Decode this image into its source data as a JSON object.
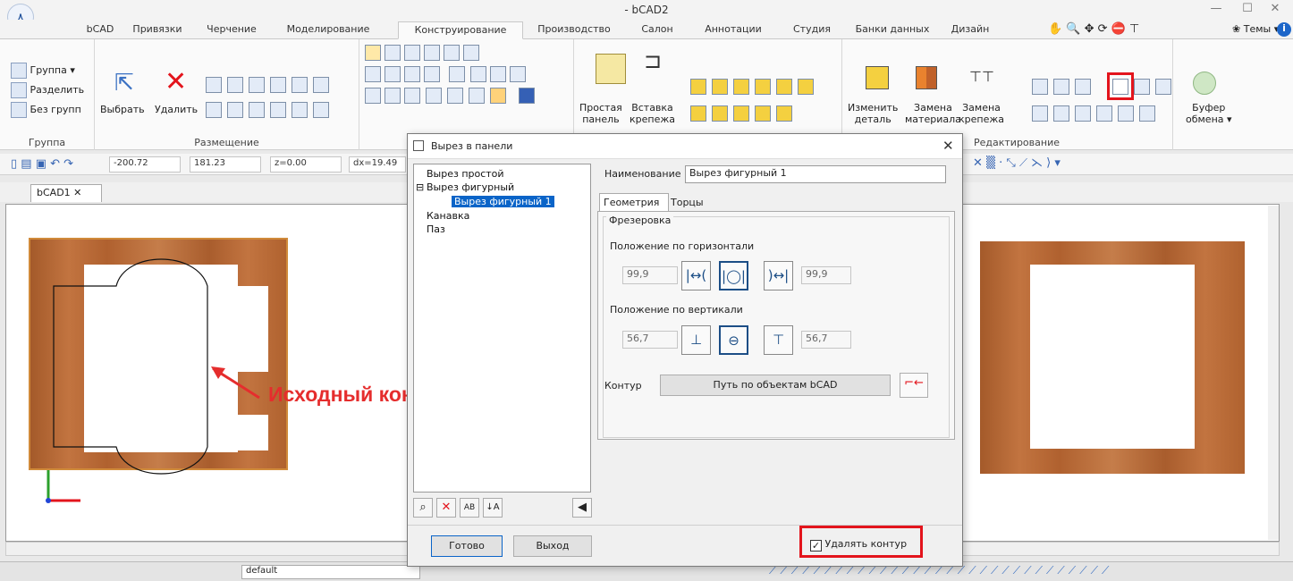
{
  "window": {
    "title": "- bCAD2",
    "minimize": "—",
    "maximize": "☐",
    "close": "✕"
  },
  "tabs": [
    "bCAD",
    "Привязки",
    "Черчение",
    "Моделирование",
    "Конструирование",
    "Производство",
    "Салон",
    "Аннотации",
    "Студия",
    "Банки данных",
    "Дизайн"
  ],
  "tabs_right": {
    "themes": "Темы"
  },
  "ribbon": {
    "group_group": {
      "label": "Группа",
      "items": [
        "Группа",
        "Разделить",
        "Без групп"
      ]
    },
    "group_place": {
      "label": "Размещение",
      "select": "Выбрать",
      "delete": "Удалить"
    },
    "panel": {
      "simple": [
        "Простая",
        "панель"
      ],
      "insert": [
        "Вставка",
        "крепежа"
      ]
    },
    "edit": {
      "label": "Редактирование",
      "change": [
        "Изменить",
        "деталь"
      ],
      "replace_mat": [
        "Замена",
        "материала"
      ],
      "replace_fix": [
        "Замена",
        "крепежа"
      ]
    },
    "buffer": [
      "Буфер",
      "обмена"
    ]
  },
  "coords": {
    "x": "-200.72",
    "y": "181.23",
    "z": "z=0.00",
    "dx": "dx=19.49"
  },
  "doc_tab": "bCAD1",
  "annotation": "Исходный контур",
  "bottom_layer": "default",
  "dialog": {
    "title": "Вырез в панели",
    "tree": {
      "simple": "Вырез простой",
      "figured": "Вырез фигурный",
      "figured1": "Вырез фигурный 1",
      "groove": "Канавка",
      "slot": "Паз"
    },
    "name_label": "Наименование",
    "name_value": "Вырез фигурный 1",
    "tab_geometry": "Геометрия",
    "tab_ends": "Торцы",
    "milling": "Фрезеровка",
    "horiz_label": "Положение по горизонтали",
    "horiz_left": "99,9",
    "horiz_right": "99,9",
    "vert_label": "Положение по вертикали",
    "vert_top": "56,7",
    "vert_bottom": "56,7",
    "contour_label": "Контур",
    "contour_button": "Путь по объектам bCAD",
    "ready": "Готово",
    "exit": "Выход",
    "delete_contour": "Удалять контур",
    "delete_contour_checked": true
  },
  "colors": {
    "accent_red": "#e3141c",
    "wood": "#b86a35",
    "selection": "#0a64c8",
    "annotation": "#e52d2d"
  }
}
